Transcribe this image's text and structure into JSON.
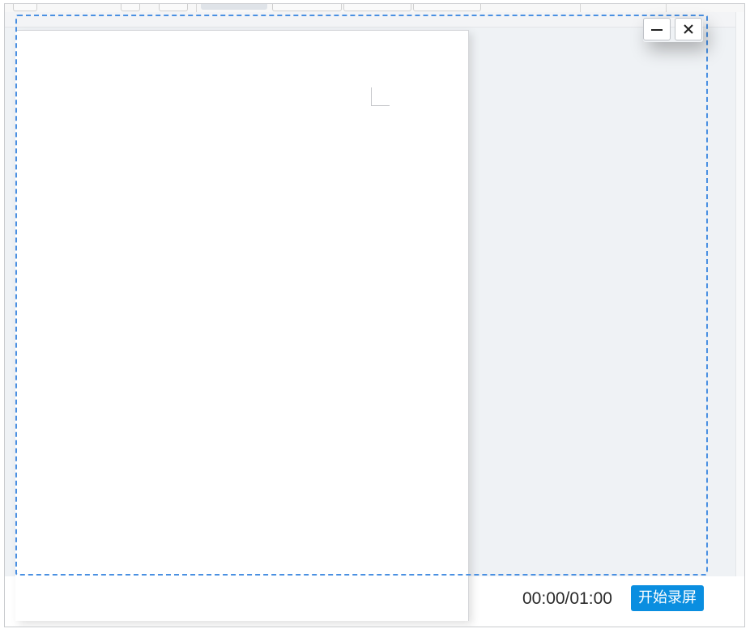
{
  "window_controls": {
    "minimize_symbol": "−",
    "close_symbol": "×"
  },
  "recorder": {
    "timer": "00:00/01:00",
    "start_label": "开始录屏"
  },
  "colors": {
    "accent": "#0a8ee0",
    "selection_border": "#4a90e2",
    "workspace_bg": "#eff2f5",
    "page_bg": "#ffffff"
  },
  "icons": {
    "minimize": "minimize-icon",
    "close": "close-icon",
    "margin_marker": "margin-corner-icon"
  }
}
